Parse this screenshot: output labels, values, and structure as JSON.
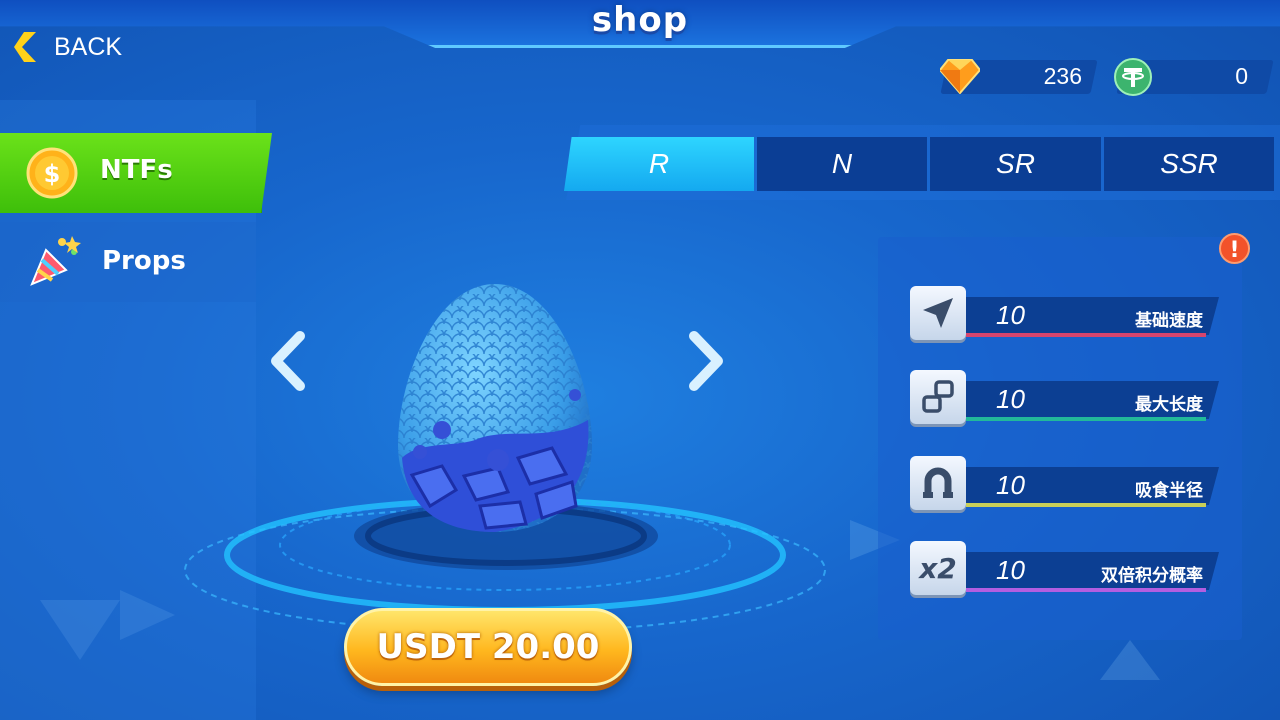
{
  "header": {
    "title": "shop"
  },
  "back": {
    "label": "BACK"
  },
  "currencies": [
    {
      "name": "gem",
      "icon": "diamond-icon",
      "value": "236"
    },
    {
      "name": "usdt",
      "icon": "tether-icon",
      "value": "0"
    }
  ],
  "sidebar": {
    "items": [
      {
        "label": "NTFs",
        "icon": "coin-icon",
        "active": true
      },
      {
        "label": "Props",
        "icon": "party-popper-icon",
        "active": false
      }
    ]
  },
  "tabs": [
    {
      "label": "R",
      "active": true
    },
    {
      "label": "N",
      "active": false
    },
    {
      "label": "SR",
      "active": false
    },
    {
      "label": "SSR",
      "active": false
    }
  ],
  "stats": [
    {
      "icon": "speed-arrow-icon",
      "value": "10",
      "label": "基础速度",
      "color": "#d6456e"
    },
    {
      "icon": "length-blocks-icon",
      "value": "10",
      "label": "最大长度",
      "color": "#22b99a"
    },
    {
      "icon": "magnet-icon",
      "value": "10",
      "label": "吸食半径",
      "color": "#c9cf58"
    },
    {
      "icon": "x2-icon",
      "icon_text": "x2",
      "value": "10",
      "label": "双倍积分概率",
      "color": "#b35ee0"
    }
  ],
  "item": {
    "name": "blue-dragon-egg",
    "price": "USDT 20.00"
  },
  "colors": {
    "accent_green": "#4fcf10",
    "tab_active": "#21c0f8",
    "price_orange": "#ffb71e"
  }
}
